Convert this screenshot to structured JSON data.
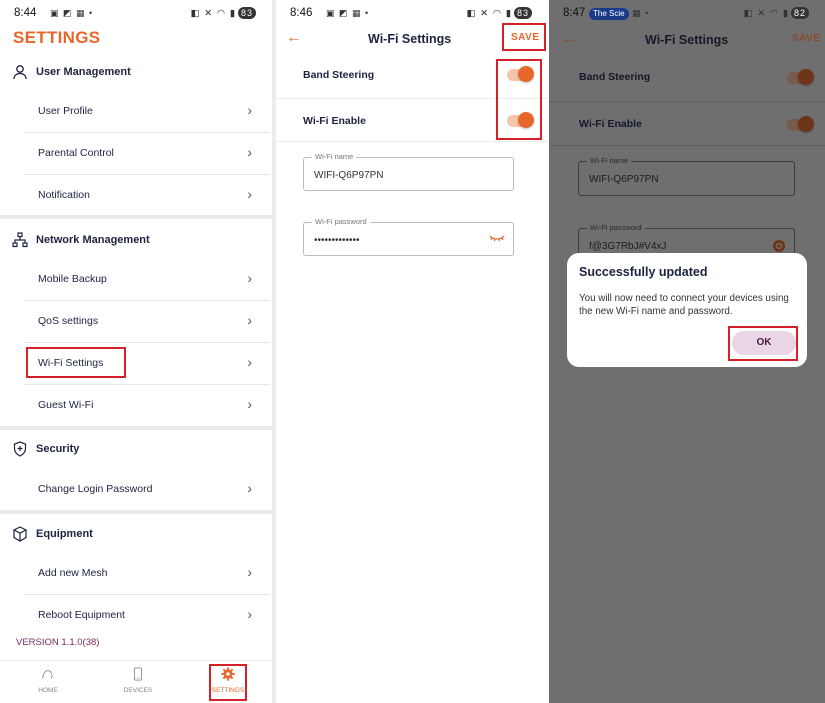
{
  "colors": {
    "accent": "#e8662a",
    "highlight": "#d32029",
    "text_dark": "#1c2340",
    "version_text": "#7a2a60"
  },
  "screen1": {
    "status_time": "8:44",
    "battery": "83",
    "title": "SETTINGS",
    "sections": {
      "user_management": "User Management",
      "network_management": "Network Management",
      "security": "Security",
      "equipment": "Equipment"
    },
    "items": {
      "user_profile": "User Profile",
      "parental_control": "Parental Control",
      "notification": "Notification",
      "mobile_backup": "Mobile Backup",
      "qos_settings": "QoS settings",
      "wifi_settings": "Wi-Fi Settings",
      "guest_wifi": "Guest Wi-Fi",
      "change_login_password": "Change Login Password",
      "add_new_mesh": "Add new Mesh",
      "reboot_equipment": "Reboot Equipment"
    },
    "version": "VERSION 1.1.0(38)",
    "nav": {
      "home": "HOME",
      "devices": "DEVICES",
      "settings": "SETTINGS"
    }
  },
  "screen2": {
    "status_time": "8:46",
    "battery": "83",
    "title": "Wi-Fi Settings",
    "save_label": "SAVE",
    "band_steering": "Band Steering",
    "wifi_enable": "Wi-Fi Enable",
    "wifi_name_label": "Wi-Fi name",
    "wifi_name_value": "WIFI-Q6P97PN",
    "wifi_password_label": "Wi-Fi password",
    "wifi_password_value": "•••••••••••••"
  },
  "screen3": {
    "status_time": "8:47",
    "battery": "82",
    "notif_text": "The Scie",
    "title": "Wi-Fi Settings",
    "save_label": "SAVE",
    "band_steering": "Band Steering",
    "wifi_enable": "Wi-Fi Enable",
    "wifi_name_label": "Wi-Fi name",
    "wifi_name_value": "WIFI-Q6P97PN",
    "wifi_password_label": "Wi-Fi password",
    "wifi_password_value": "f@3G7RbJ#V4xJ",
    "dialog_title": "Successfully updated",
    "dialog_message": "You will now need to connect your devices using the new Wi-Fi name and password.",
    "ok_label": "OK"
  }
}
